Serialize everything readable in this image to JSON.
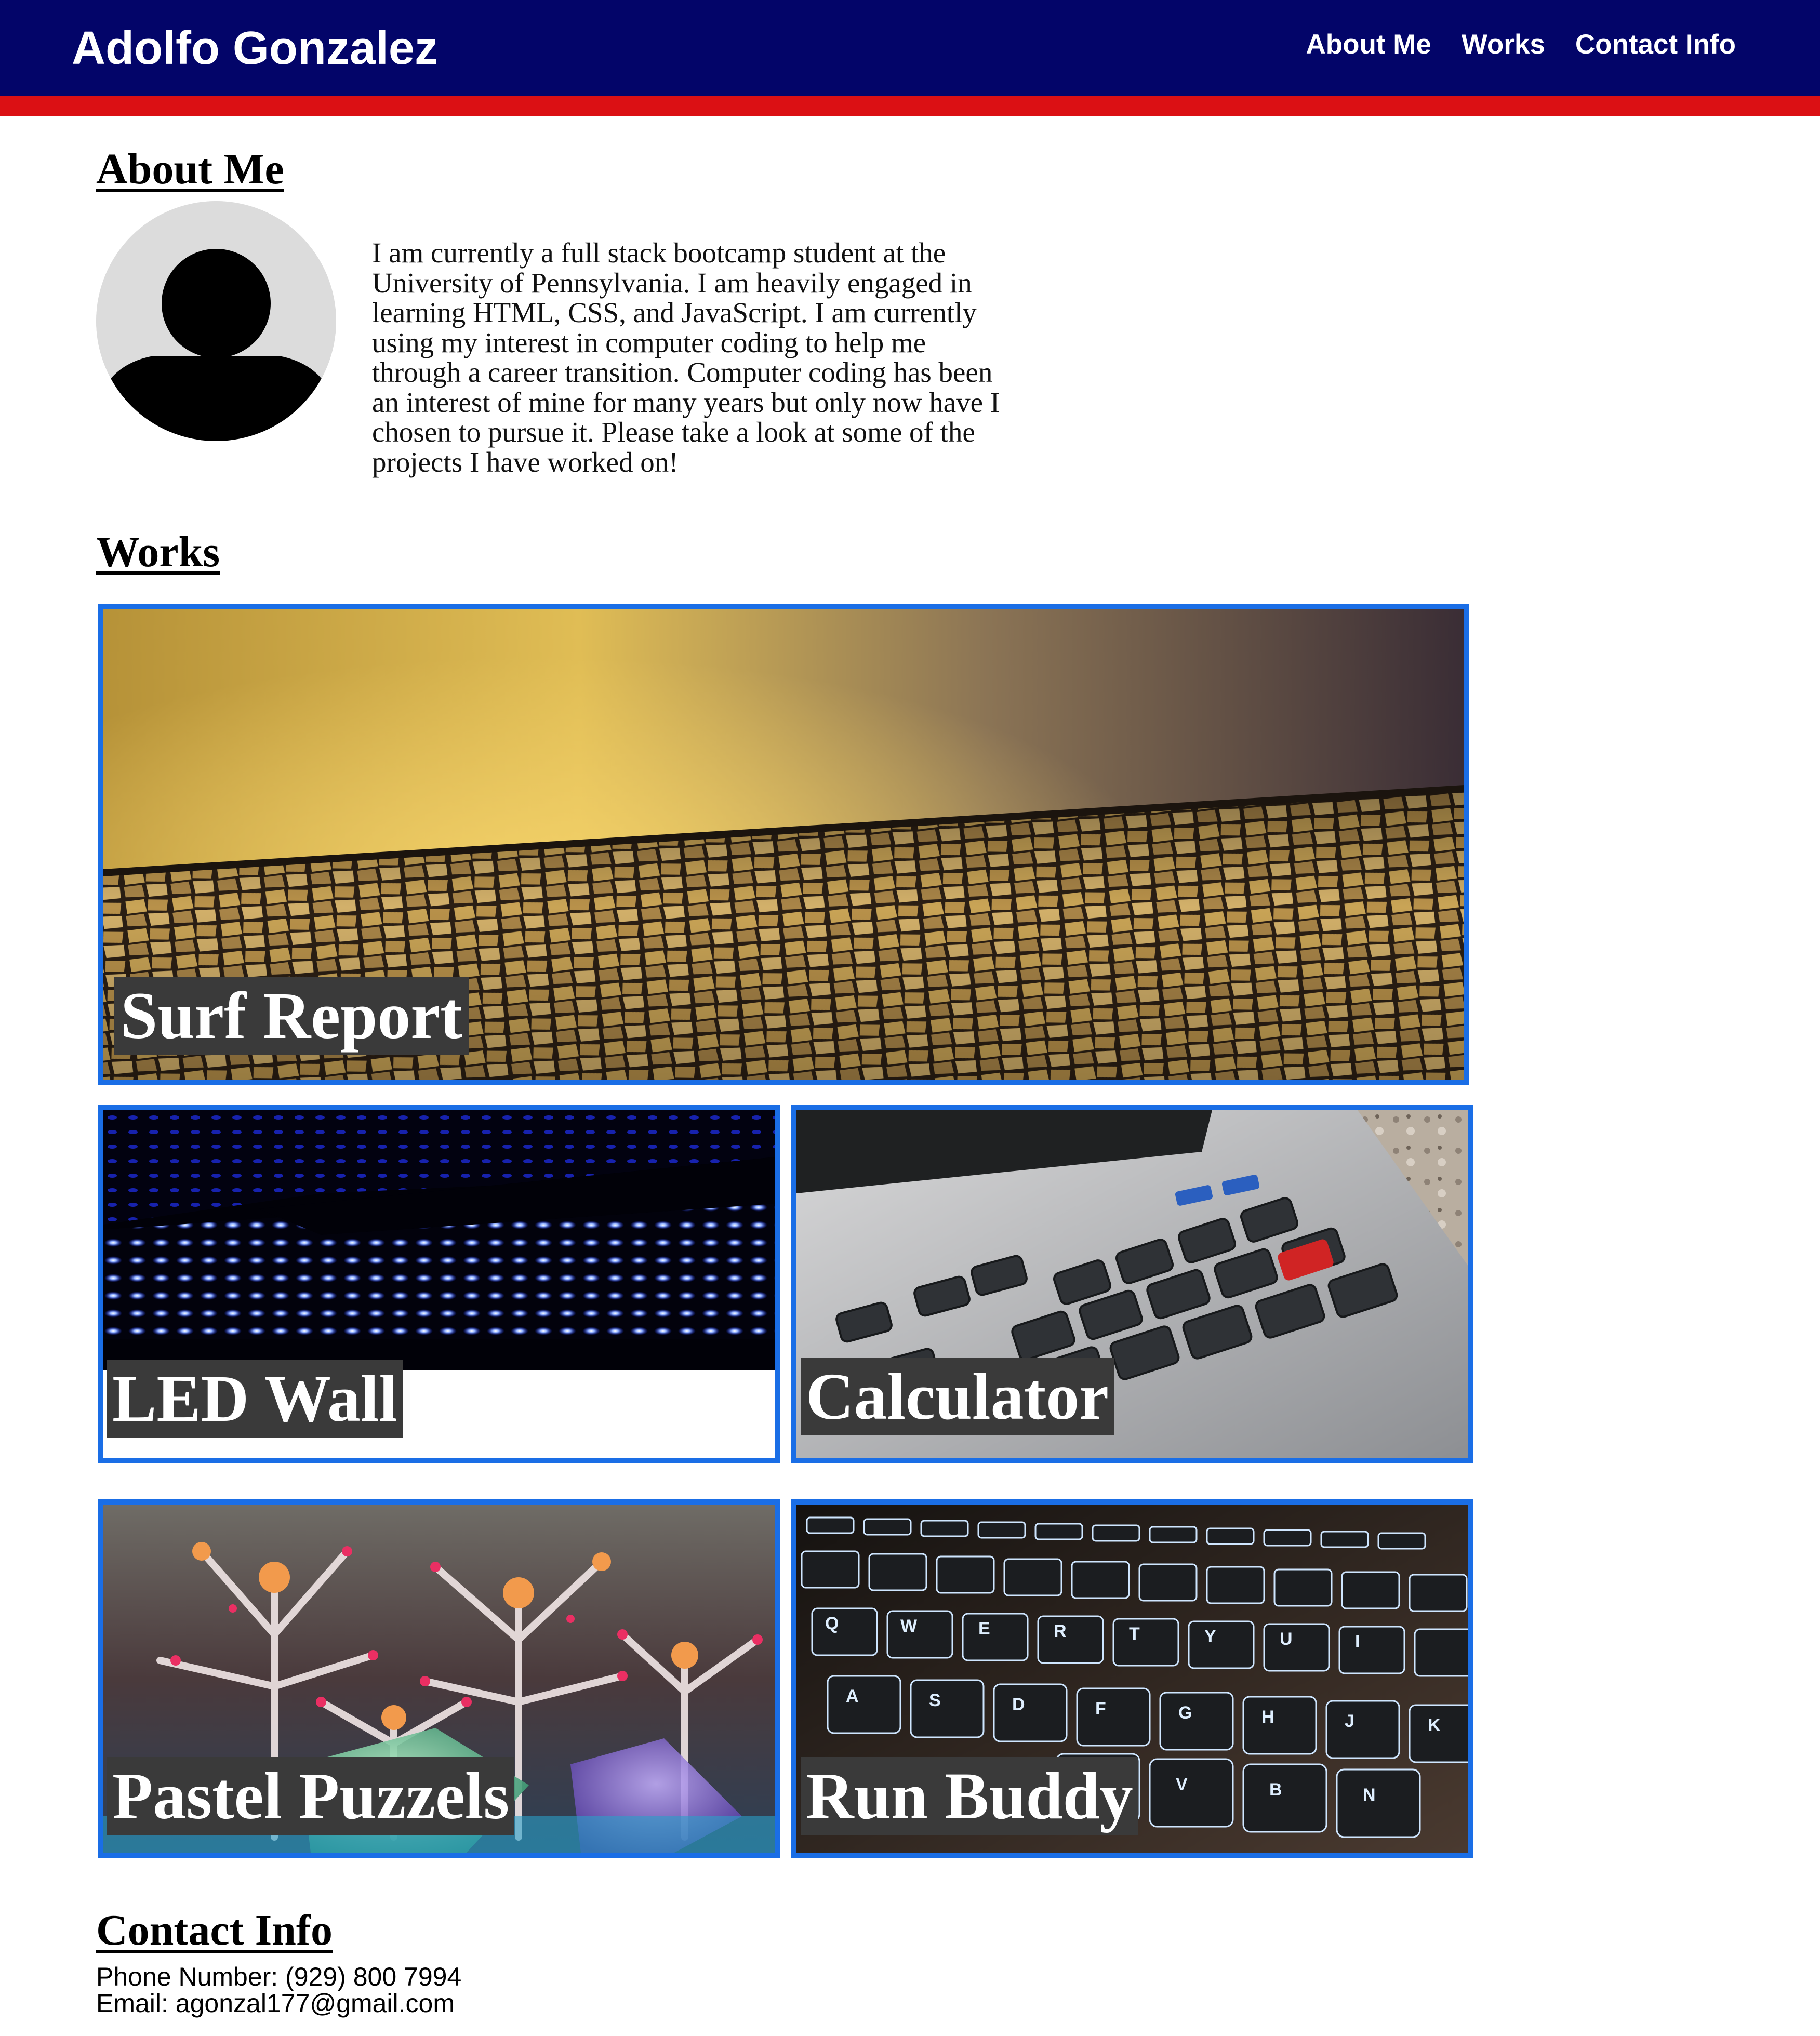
{
  "header": {
    "title": "Adolfo Gonzalez",
    "nav": [
      {
        "label": "About Me"
      },
      {
        "label": "Works"
      },
      {
        "label": "Contact Info"
      }
    ]
  },
  "about": {
    "heading": "About Me",
    "text": "I am currently a full stack bootcamp student at the University of Pennsylvania. I am heavily engaged in learning HTML, CSS, and JavaScript. I am currently using my interest in computer coding to help me through a career transition. Computer coding has been an interest of mine for many years but only now have I chosen to pursue it. Please take a look at some of the projects I have worked on!"
  },
  "works": {
    "heading": "Works",
    "projects": [
      {
        "title": "Surf Report",
        "image": "tile-mosaic-photo"
      },
      {
        "title": "LED Wall",
        "image": "blue-led-photo"
      },
      {
        "title": "Calculator",
        "image": "calculator-photo"
      },
      {
        "title": "Pastel Puzzels",
        "image": "coral-photo"
      },
      {
        "title": "Run Buddy",
        "image": "keyboard-photo"
      }
    ]
  },
  "contact": {
    "heading": "Contact Info",
    "phone": "Phone Number: (929) 800 7994",
    "email": "Email: agonzal177@gmail.com"
  },
  "colors": {
    "header_bg": "#030569",
    "header_stripe": "#db1014",
    "card_border": "#1a6ee6",
    "label_bg": "#3a3a3a"
  }
}
